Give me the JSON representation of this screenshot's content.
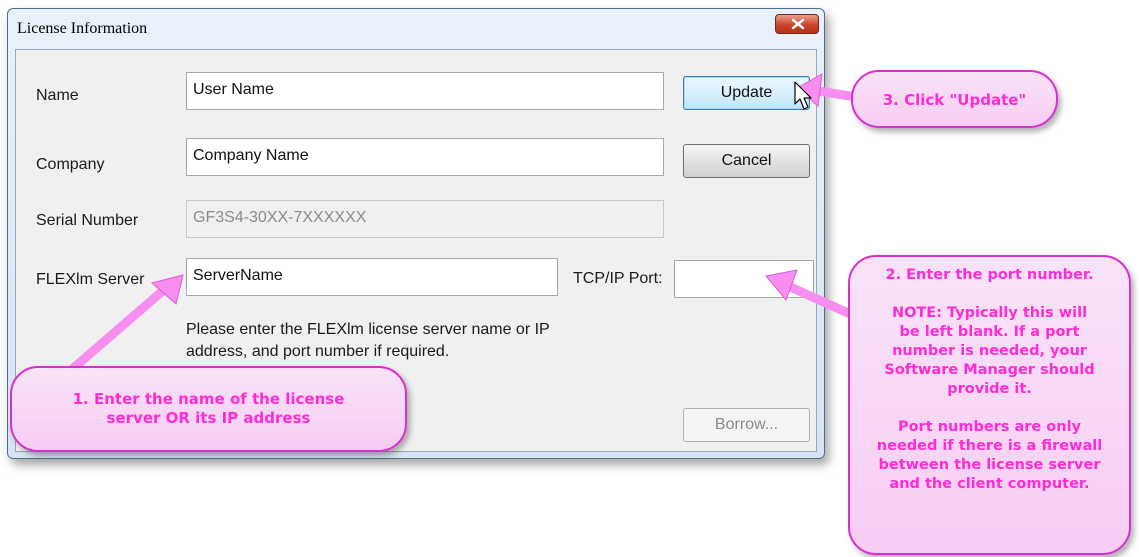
{
  "window": {
    "title": "License Information"
  },
  "form": {
    "name_label": "Name",
    "name_value": "User Name",
    "company_label": "Company",
    "company_value": "Company Name",
    "serial_label": "Serial Number",
    "serial_value": "GF3S4-30XX-7XXXXXX",
    "server_label": "FLEXlm Server",
    "server_value": "ServerName",
    "port_label": "TCP/IP Port:",
    "port_value": "",
    "help_line1": "Please enter the FLEXlm license server name or IP",
    "help_line2": "address, and port number if required."
  },
  "buttons": {
    "update": "Update",
    "cancel": "Cancel",
    "borrow": "Borrow..."
  },
  "callouts": {
    "step1": {
      "lines": [
        "1. Enter the name of the license",
        "server OR its IP address"
      ]
    },
    "step2": {
      "lines": [
        "2. Enter the port number.",
        "",
        "NOTE: Typically this will",
        "be left blank.  If a port",
        "number is needed, your",
        "Software Manager should",
        "provide it.",
        "",
        "Port numbers are only",
        "needed if there is a firewall",
        "between the license server",
        "and the client computer."
      ]
    },
    "step3": {
      "lines": [
        "3. Click \"Update\""
      ]
    }
  },
  "colors": {
    "callout_text": "#ff2bd6",
    "callout_border": "#d92ed0",
    "arrow": "#f78ef0"
  }
}
